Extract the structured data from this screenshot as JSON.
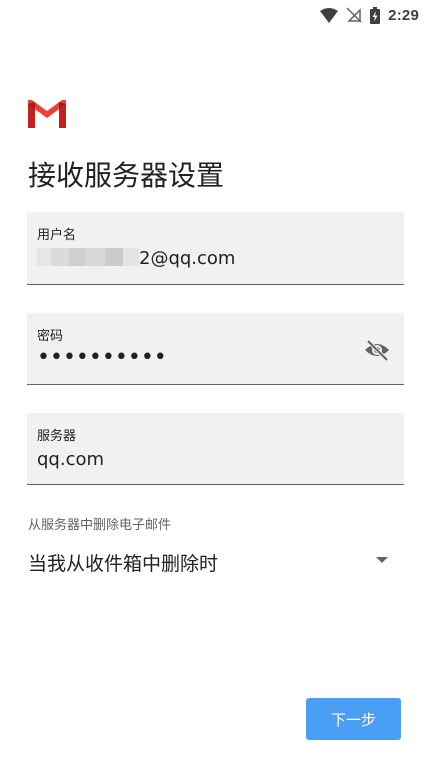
{
  "status_bar": {
    "time": "2:29",
    "icons": [
      "wifi-icon",
      "no-sim-icon",
      "battery-charging-icon"
    ]
  },
  "app": {
    "logo": "gmail-logo"
  },
  "page": {
    "title": "接收服务器设置"
  },
  "fields": {
    "username": {
      "label": "用户名",
      "value_suffix": "2@qq.com"
    },
    "password": {
      "label": "密码",
      "value": "••••••••••",
      "toggle_icon": "visibility-off-icon"
    },
    "server": {
      "label": "服务器",
      "value": "qq.com"
    }
  },
  "delete_policy": {
    "label": "从服务器中删除电子邮件",
    "selected": "当我从收件箱中删除时"
  },
  "actions": {
    "next_label": "下一步"
  },
  "colors": {
    "accent": "#4a9ff5",
    "gmail_red": "#d93025",
    "field_bg": "#f1f1f1",
    "underline": "#5f6368"
  }
}
